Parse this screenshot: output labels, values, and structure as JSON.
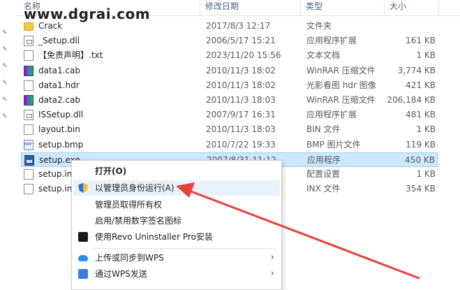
{
  "header": {
    "name": "名称",
    "date": "修改日期",
    "type": "类型",
    "size": "大小"
  },
  "watermark": "www.dgrai.com",
  "files": [
    {
      "name": "Crack",
      "date": "2017/8/3 12:17",
      "type": "文件夹",
      "size": "",
      "icon": "folder-icon"
    },
    {
      "name": "_Setup.dll",
      "date": "2006/5/17 15:21",
      "type": "应用程序扩展",
      "size": "161 KB",
      "icon": "dll-icon"
    },
    {
      "name": "【免责声明】.txt",
      "date": "2023/11/20 15:56",
      "type": "文本文档",
      "size": "1 KB",
      "icon": "file-icon"
    },
    {
      "name": "data1.cab",
      "date": "2010/11/3 18:02",
      "type": "WinRAR 压缩文件",
      "size": "3,774 KB",
      "icon": "rar-icon"
    },
    {
      "name": "data1.hdr",
      "date": "2010/11/3 18:02",
      "type": "光影看图 hdr 图像",
      "size": "421 KB",
      "icon": "file-icon"
    },
    {
      "name": "data2.cab",
      "date": "2010/11/3 18:03",
      "type": "WinRAR 压缩文件",
      "size": "206,184 KB",
      "icon": "rar-icon"
    },
    {
      "name": "ISSetup.dll",
      "date": "2007/9/17 16:31",
      "type": "应用程序扩展",
      "size": "481 KB",
      "icon": "dll-icon"
    },
    {
      "name": "layout.bin",
      "date": "2010/11/3 18:03",
      "type": "BIN 文件",
      "size": "1 KB",
      "icon": "file-icon"
    },
    {
      "name": "setup.bmp",
      "date": "2010/7/22 19:33",
      "type": "BMP 图片文件",
      "size": "119 KB",
      "icon": "bmp-icon"
    },
    {
      "name": "setup.exe",
      "date": "2007/8/31 11:12",
      "type": "应用程序",
      "size": "450 KB",
      "icon": "exe-icon"
    },
    {
      "name": "setup.in",
      "date": "",
      "type": "配置设置",
      "size": "1 KB",
      "icon": "file-icon"
    },
    {
      "name": "setup.in",
      "date": "",
      "type": "INX 文件",
      "size": "354 KB",
      "icon": "file-icon"
    }
  ],
  "context_menu": {
    "open": "打开(O)",
    "run_as_admin": "以管理员身份运行(A)",
    "take_ownership": "管理员取得所有权",
    "toggle_signature": "启用/禁用数字签名图标",
    "revo": "使用Revo Uninstaller Pro安装",
    "upload_wps": "上传或同步到WPS",
    "send_wps": "通过WPS发送"
  },
  "colors": {
    "selection": "#cce8ff",
    "arrow": "#e8413a",
    "header_text": "#4c607a"
  }
}
